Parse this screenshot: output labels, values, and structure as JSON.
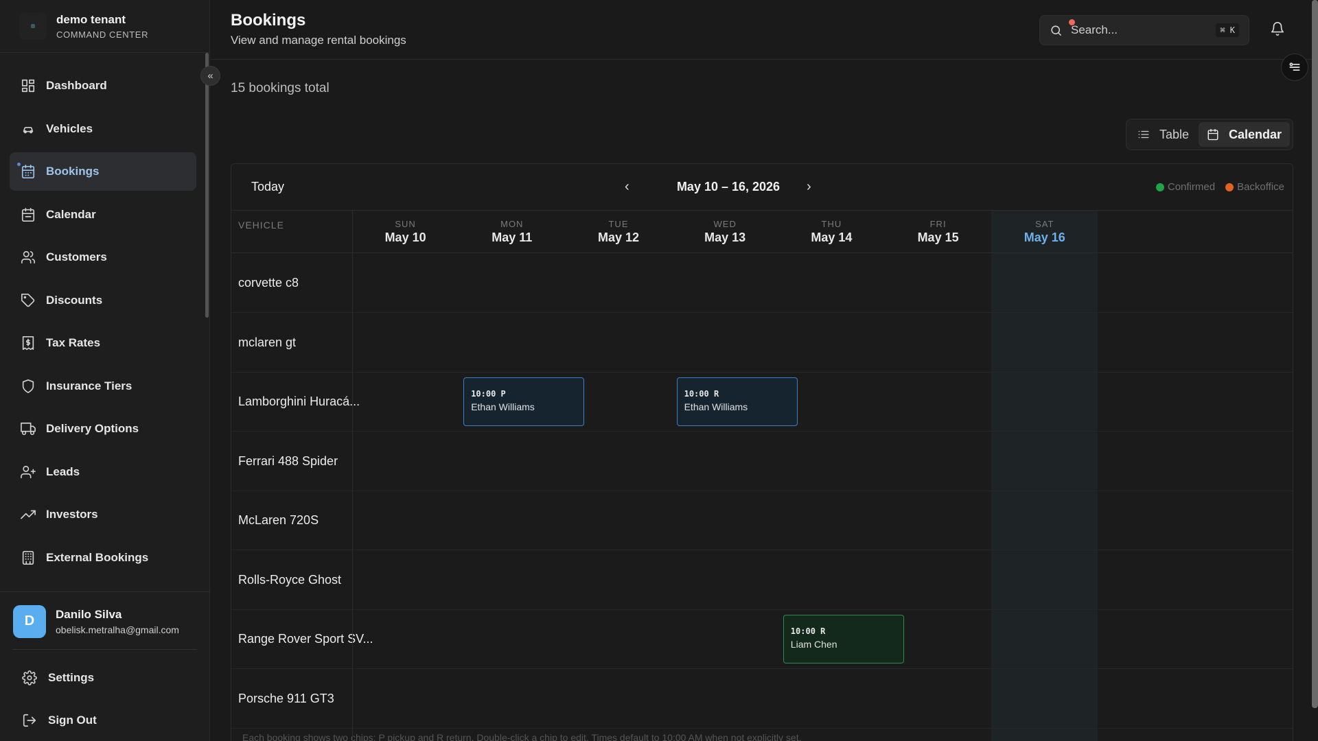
{
  "tenant": {
    "name": "demo tenant",
    "subtitle": "COMMAND CENTER"
  },
  "nav": [
    {
      "label": "Dashboard",
      "icon": "dashboard-icon"
    },
    {
      "label": "Vehicles",
      "icon": "car-icon"
    },
    {
      "label": "Bookings",
      "icon": "calendar-check-icon",
      "active": true
    },
    {
      "label": "Calendar",
      "icon": "calendar-icon"
    },
    {
      "label": "Customers",
      "icon": "users-icon"
    },
    {
      "label": "Discounts",
      "icon": "tag-icon"
    },
    {
      "label": "Tax Rates",
      "icon": "receipt-icon"
    },
    {
      "label": "Insurance Tiers",
      "icon": "shield-icon"
    },
    {
      "label": "Delivery Options",
      "icon": "truck-icon"
    },
    {
      "label": "Leads",
      "icon": "user-plus-icon"
    },
    {
      "label": "Investors",
      "icon": "trending-up-icon"
    },
    {
      "label": "External Bookings",
      "icon": "building-icon"
    }
  ],
  "user": {
    "initial": "D",
    "name": "Danilo Silva",
    "email": "obelisk.metralha@gmail.com"
  },
  "bottom": {
    "settings": "Settings",
    "signout": "Sign Out"
  },
  "header": {
    "title": "Bookings",
    "subtitle": "View and manage rental bookings",
    "search_placeholder": "Search...",
    "shortcut": "⌘ K"
  },
  "main": {
    "total": "15 bookings total",
    "view_table": "Table",
    "view_calendar": "Calendar"
  },
  "calendar": {
    "today_label": "Today",
    "week_label": "May 10 – 16, 2026",
    "legend": [
      {
        "label": "Confirmed",
        "color": "#22a34a"
      },
      {
        "label": "Backoffice",
        "color": "#e0631f"
      }
    ],
    "vehicle_header": "VEHICLE",
    "days": [
      {
        "dow": "SUN",
        "date": "May 10"
      },
      {
        "dow": "MON",
        "date": "May 11"
      },
      {
        "dow": "TUE",
        "date": "May 12"
      },
      {
        "dow": "WED",
        "date": "May 13"
      },
      {
        "dow": "THU",
        "date": "May 14"
      },
      {
        "dow": "FRI",
        "date": "May 15"
      },
      {
        "dow": "SAT",
        "date": "May 16",
        "today": true
      }
    ],
    "vehicles": [
      "corvette c8",
      "mclaren gt",
      "Lamborghini Huracá...",
      "Ferrari 488 Spider",
      "McLaren 720S",
      "Rolls-Royce Ghost",
      "Range Rover Sport SV...",
      "Porsche 911 GT3"
    ],
    "chips": [
      {
        "row": 2,
        "day": 1,
        "time": "10:00 P",
        "name": "Ethan Williams",
        "style": "blue"
      },
      {
        "row": 2,
        "day": 3,
        "time": "10:00 R",
        "name": "Ethan Williams",
        "style": "blue"
      },
      {
        "row": 6,
        "day": 4,
        "time": "10:00 R",
        "name": "Liam Chen",
        "style": "green"
      }
    ],
    "footer_note": "Each booking shows two chips: P pickup and R return. Double-click a chip to edit. Times default to 10:00 AM when not explicitly set."
  }
}
